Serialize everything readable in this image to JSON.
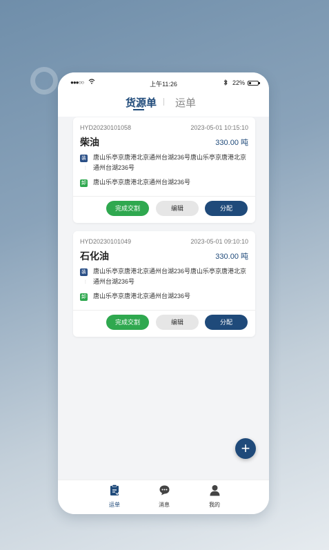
{
  "status_bar": {
    "signal": "●●●○○",
    "time": "上午11:26",
    "battery": "22%",
    "battery_level": 0.22
  },
  "tabs": [
    {
      "label": "货源单",
      "active": true
    },
    {
      "label": "运单",
      "active": false
    }
  ],
  "cards": [
    {
      "id": "HYD20230101058",
      "date": "2023-05-01 10:15:10",
      "cargo": "柴油",
      "weight": "330.00 吨",
      "load_tag": "装",
      "load_address": "唐山乐亭京唐港北京通州台湖236号唐山乐亭京唐港北京通州台湖236号",
      "unload_tag": "卸",
      "unload_address": "唐山乐亭京唐港北京通州台湖236号",
      "buttons": {
        "done": "完成交割",
        "edit": "编辑",
        "assign": "分配"
      }
    },
    {
      "id": "HYD20230101049",
      "date": "2023-05-01 09:10:10",
      "cargo": "石化油",
      "weight": "330.00 吨",
      "load_tag": "装",
      "load_address": "唐山乐亭京唐港北京通州台湖236号唐山乐亭京唐港北京通州台湖236号",
      "unload_tag": "卸",
      "unload_address": "唐山乐亭京唐港北京通州台湖236号",
      "buttons": {
        "done": "完成交割",
        "edit": "编辑",
        "assign": "分配"
      }
    }
  ],
  "fab": {
    "icon": "plus-icon",
    "glyph": "+"
  },
  "bottom_nav": [
    {
      "label": "运单",
      "icon": "waybill-icon",
      "active": true
    },
    {
      "label": "消息",
      "icon": "message-icon",
      "active": false
    },
    {
      "label": "我的",
      "icon": "user-icon",
      "active": false
    }
  ],
  "colors": {
    "primary": "#1f4a7a",
    "green": "#2fa84f",
    "load_tag": "#2a4f86"
  }
}
